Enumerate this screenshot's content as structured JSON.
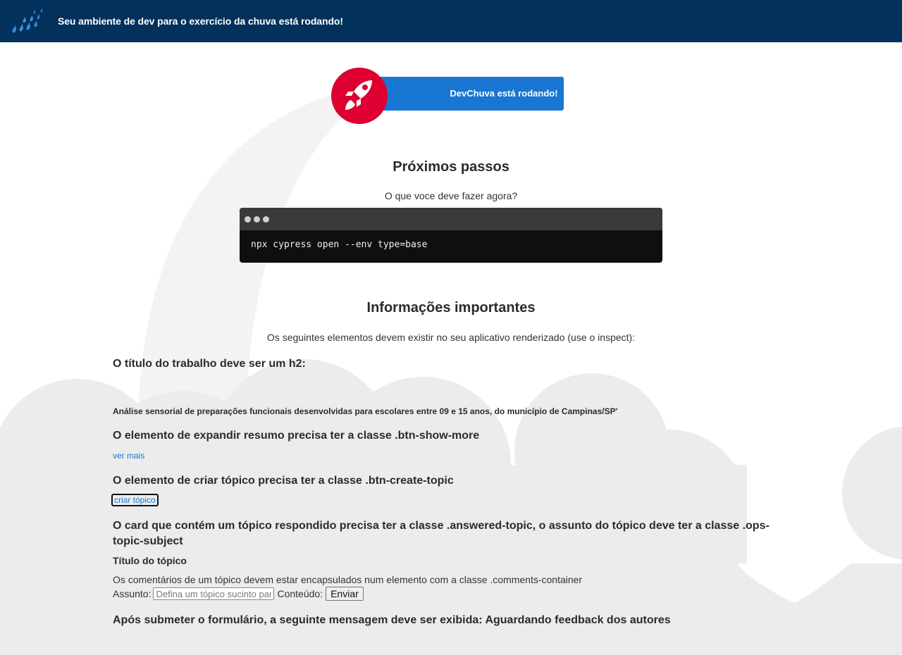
{
  "header": {
    "title": "Seu ambiente de dev para o exercício da chuva está rodando!",
    "logo_icon": "rain-drops-icon"
  },
  "badge": {
    "label": "DevChuva está rodando!",
    "icon": "rocket-icon",
    "circle_color": "#dd0031",
    "bar_color": "#1976d2"
  },
  "next_steps": {
    "title": "Próximos passos",
    "subtitle": "O que voce deve fazer agora?",
    "command": "npx cypress open --env type=base"
  },
  "important": {
    "title": "Informações importantes",
    "subtitle": "Os seguintes elementos devem existir no seu aplicativo renderizado (use o inspect):"
  },
  "requirements": {
    "h2_req": "O título do trabalho deve ser um h2:",
    "h2_example": "Análise sensorial de preparações funcionais desenvolvidas para escolares entre 09 e 15 anos, do município de Campinas/SP'",
    "show_more_req": "O elemento de expandir resumo precisa ter a classe .btn-show-more",
    "show_more_link": "ver mais",
    "create_topic_req": "O elemento de criar tópico precisa ter a classe .btn-create-topic",
    "create_topic_button": "criar tópico",
    "answered_req": "O card que contém um tópico respondido precisa ter a classe .answered-topic, o assunto do tópico deve ter a classe .ops-topic-subject",
    "topic_title": "Título do tópico",
    "comments_text": "Os comentários de um tópico devem estar encapsulados num elemento com a classe .comments-container",
    "subject_label": "Assunto:",
    "subject_placeholder": "Defina um tópico sucinto para notificar os autores",
    "content_label": "Conteúdo:",
    "submit_label": "Enviar",
    "after_submit_req": "Após submeter o formulário, a seguinte mensagem deve ser exibida: Aguardando feedback dos autores"
  }
}
